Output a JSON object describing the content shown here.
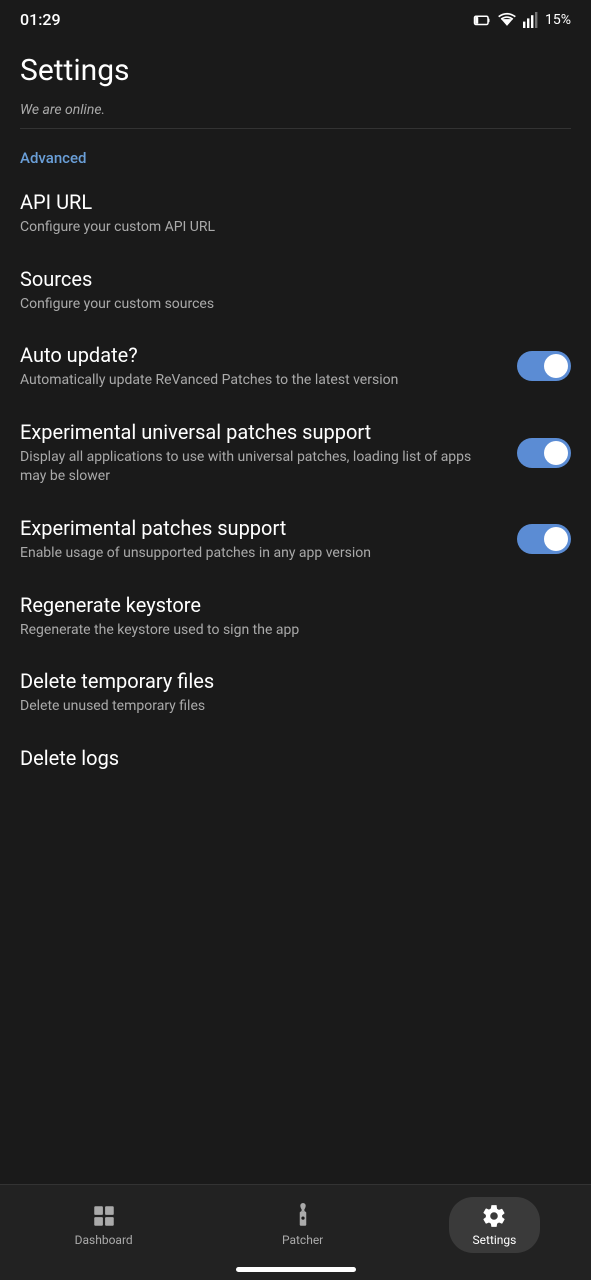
{
  "statusBar": {
    "time": "01:29",
    "battery": "15%",
    "batteryIcon": "🔋",
    "networkIcon": "▲"
  },
  "pageTitle": "Settings",
  "onlineBanner": "We are online.",
  "sections": [
    {
      "id": "advanced",
      "label": "Advanced",
      "items": [
        {
          "id": "api-url",
          "title": "API URL",
          "subtitle": "Configure your custom API URL",
          "hasToggle": false
        },
        {
          "id": "sources",
          "title": "Sources",
          "subtitle": "Configure your custom sources",
          "hasToggle": false
        },
        {
          "id": "auto-update",
          "title": "Auto update?",
          "subtitle": "Automatically update ReVanced Patches to the latest version",
          "hasToggle": true,
          "toggleOn": true
        },
        {
          "id": "exp-universal-patches",
          "title": "Experimental universal patches support",
          "subtitle": "Display all applications to use with universal patches, loading list of apps may be slower",
          "hasToggle": true,
          "toggleOn": true
        },
        {
          "id": "exp-patches-support",
          "title": "Experimental patches support",
          "subtitle": "Enable usage of unsupported patches in any app version",
          "hasToggle": true,
          "toggleOn": true
        },
        {
          "id": "regenerate-keystore",
          "title": "Regenerate keystore",
          "subtitle": "Regenerate the keystore used to sign the app",
          "hasToggle": false
        },
        {
          "id": "delete-temp-files",
          "title": "Delete temporary files",
          "subtitle": "Delete unused temporary files",
          "hasToggle": false
        },
        {
          "id": "delete-logs",
          "title": "Delete logs",
          "subtitle": "",
          "hasToggle": false
        }
      ]
    }
  ],
  "bottomNav": {
    "items": [
      {
        "id": "dashboard",
        "label": "Dashboard",
        "active": false
      },
      {
        "id": "patcher",
        "label": "Patcher",
        "active": false
      },
      {
        "id": "settings",
        "label": "Settings",
        "active": true
      }
    ]
  }
}
